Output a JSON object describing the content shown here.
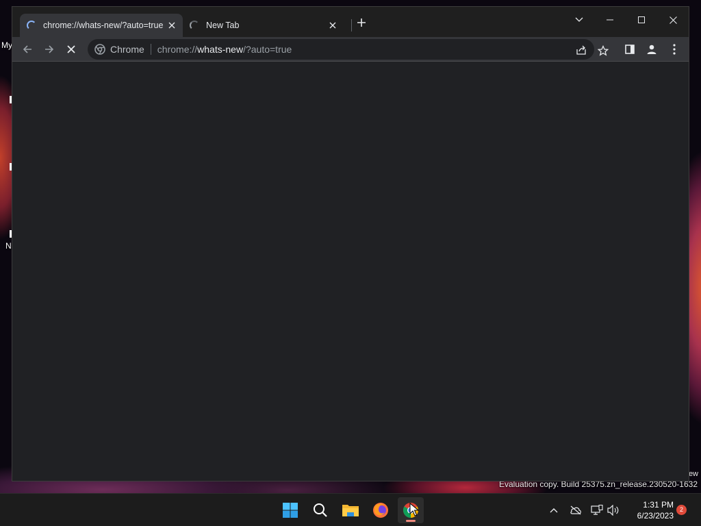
{
  "desktop": {
    "label_my": "My",
    "label_n": "N",
    "label_edge": "ew",
    "watermark": "Evaluation copy. Build 25375.zn_release.230520-1632"
  },
  "browser": {
    "tabs": [
      {
        "title": "chrome://whats-new/?auto=true",
        "active": true,
        "loading": true,
        "close_icon": "close-icon"
      },
      {
        "title": "New Tab",
        "active": false,
        "loading": true,
        "close_icon": "close-icon"
      }
    ],
    "new_tab_icon": "plus-icon",
    "window_controls": [
      "tab-search-icon",
      "minimize-icon",
      "maximize-icon",
      "close-icon"
    ],
    "toolbar": {
      "back_icon": "arrow-left-icon",
      "forward_icon": "arrow-right-icon",
      "stop_icon": "stop-loading-icon",
      "chip_label": "Chrome",
      "url_scheme": "chrome://",
      "url_host": "whats-new",
      "url_rest": "/?auto=true",
      "share_icon": "share-icon",
      "bookmark_icon": "star-icon",
      "side_panel_icon": "side-panel-icon",
      "profile_icon": "profile-icon",
      "menu_icon": "kebab-menu-icon"
    }
  },
  "taskbar": {
    "apps": [
      "windows-start-icon",
      "search-icon",
      "file-explorer-icon",
      "firefox-icon",
      "chrome-icon"
    ],
    "active_app": "chrome-icon",
    "tray_icons": [
      "chevron-up-icon",
      "onedrive-offline-icon",
      "network-icon",
      "volume-icon"
    ],
    "time": "1:31 PM",
    "date": "6/23/2023",
    "notification_count": "2"
  },
  "colors": {
    "window_bg": "#202124",
    "toolbar_bg": "#35363a",
    "titlebar_bg": "#1f1f1f",
    "accent_spinner": "#8ab4f8",
    "taskbar_bg": "#1c1c1c",
    "running_indicator": "#f08a7e"
  }
}
